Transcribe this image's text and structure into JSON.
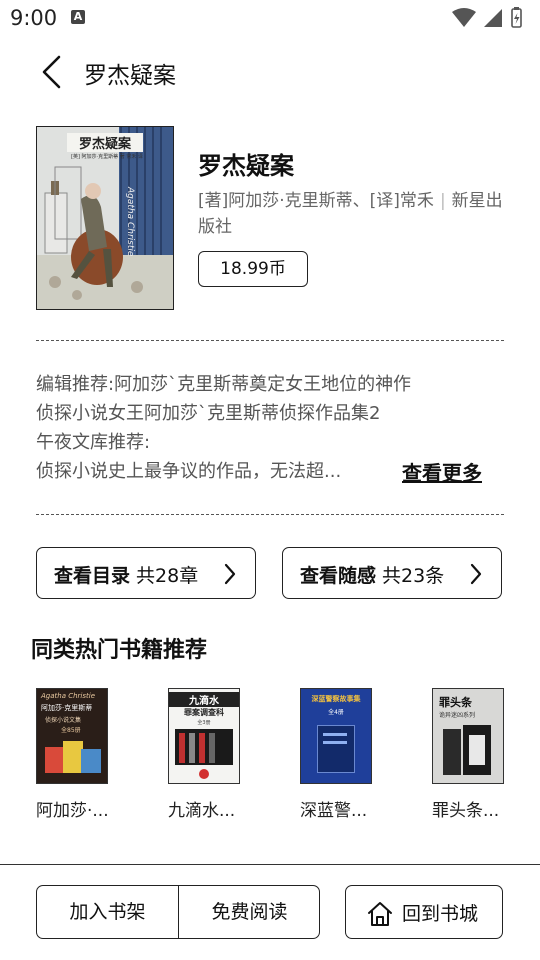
{
  "status_bar": {
    "time": "9:00",
    "notification_letter": "A"
  },
  "header": {
    "title": "罗杰疑案"
  },
  "book": {
    "title": "罗杰疑案",
    "authors": "[著]阿加莎·克里斯蒂、[译]常禾",
    "separator": "|",
    "publisher": "新星出版社",
    "price": "18.99币",
    "cover_text": {
      "title": "罗杰疑案",
      "signature": "Agatha Christie",
      "sub": "[英] 阿加莎·克里斯蒂 著 常禾 译"
    }
  },
  "description": {
    "lines": [
      "编辑推荐:阿加莎`克里斯蒂奠定女王地位的神作",
      "侦探小说女王阿加莎`克里斯蒂侦探作品集2",
      "午夜文库推荐:",
      "侦探小说史上最争议的作品，无法超..."
    ],
    "more_label": "查看更多"
  },
  "buttons": {
    "catalog": {
      "label": "查看目录",
      "count": "共28章"
    },
    "notes": {
      "label": "查看随感",
      "count": "共23条"
    }
  },
  "recommendations": {
    "title": "同类热门书籍推荐",
    "items": [
      {
        "name": "阿加莎·...",
        "cover_title": "阿加莎·克里斯蒂",
        "cover_sub": "侦探小说文集",
        "cover_tag": "全85册",
        "cover_signature": "Agatha Christie"
      },
      {
        "name": "九滴水...",
        "cover_title": "九滴水",
        "cover_sub": "罪案调查科",
        "cover_tag": "全3册"
      },
      {
        "name": "深蓝警...",
        "cover_title": "深蓝警察故事集",
        "cover_tag": "全4册"
      },
      {
        "name": "罪头条...",
        "cover_title": "罪头条",
        "cover_sub": "诡异迷凶系列"
      }
    ]
  },
  "bottom_bar": {
    "add_shelf": "加入书架",
    "free_read": "免费阅读",
    "back_store": "回到书城"
  }
}
